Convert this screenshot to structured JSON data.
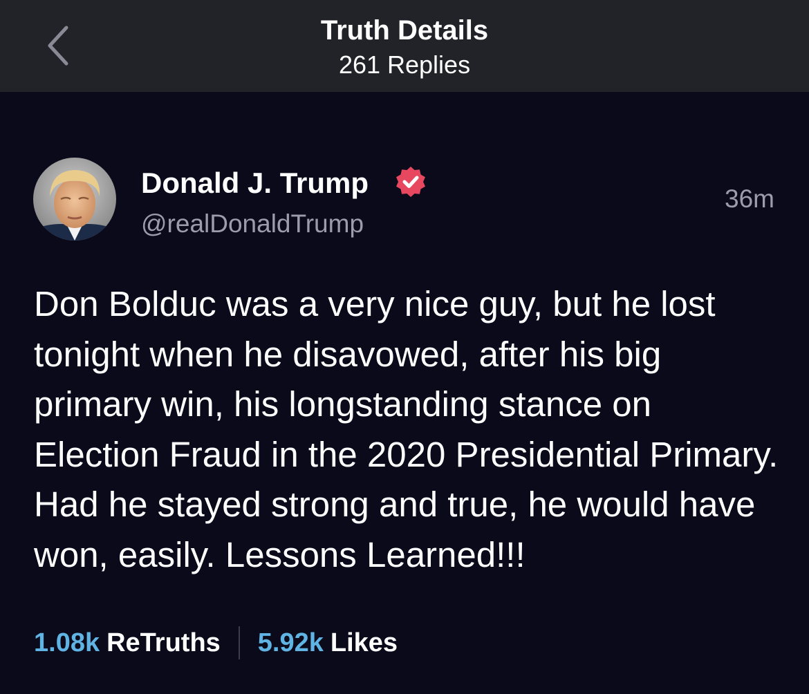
{
  "header": {
    "title": "Truth Details",
    "subtitle": "261 Replies",
    "back_icon": "chevron-left-icon"
  },
  "post": {
    "author_name": "Donald J. Trump",
    "author_handle": "@realDonaldTrump",
    "verified_icon": "verified-badge-icon",
    "verified_color": "#e8485f",
    "timestamp": "36m",
    "body": "Don Bolduc was a very nice guy, but he lost tonight when he disavowed, after his big primary win, his longstanding stance on Election Fraud in the 2020 Presidential Primary. Had he stayed strong and true, he would have won, easily. Lessons Learned!!!"
  },
  "stats": {
    "retruths_count": "1.08k",
    "retruths_label": "ReTruths",
    "likes_count": "5.92k",
    "likes_label": "Likes"
  },
  "colors": {
    "background": "#0b0a1b",
    "header_background": "#222229",
    "accent": "#5fb4e4",
    "muted_text": "#9c9caa"
  }
}
